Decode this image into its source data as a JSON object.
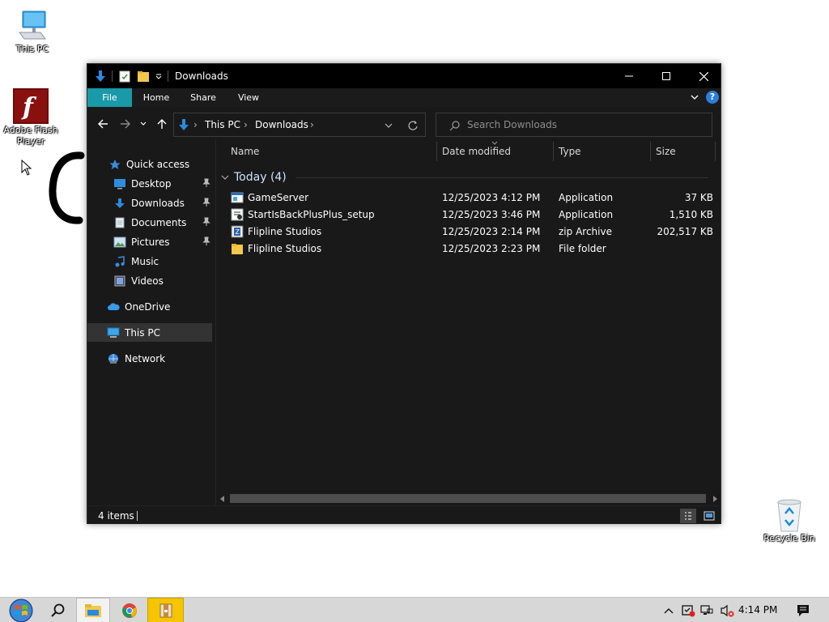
{
  "desktop": {
    "icons": [
      {
        "label": "This PC"
      },
      {
        "label": "Adobe Flash Player"
      },
      {
        "label": "Recycle Bin"
      }
    ]
  },
  "window": {
    "title": "Downloads",
    "ribbon_tabs": [
      "File",
      "Home",
      "Share",
      "View"
    ],
    "breadcrumb": [
      "This PC",
      "Downloads"
    ],
    "search_placeholder": "Search Downloads"
  },
  "nav_pane": {
    "items": [
      {
        "label": "Quick access",
        "icon": "star-icon"
      },
      {
        "label": "Desktop",
        "icon": "desktop-icon",
        "pinned": true
      },
      {
        "label": "Downloads",
        "icon": "download-arrow-icon",
        "pinned": true
      },
      {
        "label": "Documents",
        "icon": "document-icon",
        "pinned": true
      },
      {
        "label": "Pictures",
        "icon": "pictures-icon",
        "pinned": true
      },
      {
        "label": "Music",
        "icon": "music-icon"
      },
      {
        "label": "Videos",
        "icon": "videos-icon"
      },
      {
        "label": "OneDrive",
        "icon": "cloud-icon"
      },
      {
        "label": "This PC",
        "icon": "computer-icon",
        "selected": true
      },
      {
        "label": "Network",
        "icon": "network-icon"
      }
    ]
  },
  "file_list": {
    "columns": [
      "Name",
      "Date modified",
      "Type",
      "Size"
    ],
    "group_label": "Today (4)",
    "rows": [
      {
        "name": "GameServer",
        "date": "12/25/2023 4:12 PM",
        "type": "Application",
        "size": "37 KB",
        "icon": "application-icon"
      },
      {
        "name": "StartIsBackPlusPlus_setup",
        "date": "12/25/2023 3:46 PM",
        "type": "Application",
        "size": "1,510 KB",
        "icon": "installer-icon"
      },
      {
        "name": "Flipline Studios",
        "date": "12/25/2023 2:14 PM",
        "type": "zip Archive",
        "size": "202,517 KB",
        "icon": "zip-icon"
      },
      {
        "name": "Flipline Studios",
        "date": "12/25/2023 2:23 PM",
        "type": "File folder",
        "size": "",
        "icon": "folder-icon"
      }
    ]
  },
  "status": {
    "item_count": "4 items"
  },
  "taskbar": {
    "clock": "4:14 PM"
  },
  "colors": {
    "accent": "#1a99a8",
    "window_bg": "#191919",
    "titlebar_bg": "#000000",
    "taskbar_bg": "#d7d7d7"
  }
}
